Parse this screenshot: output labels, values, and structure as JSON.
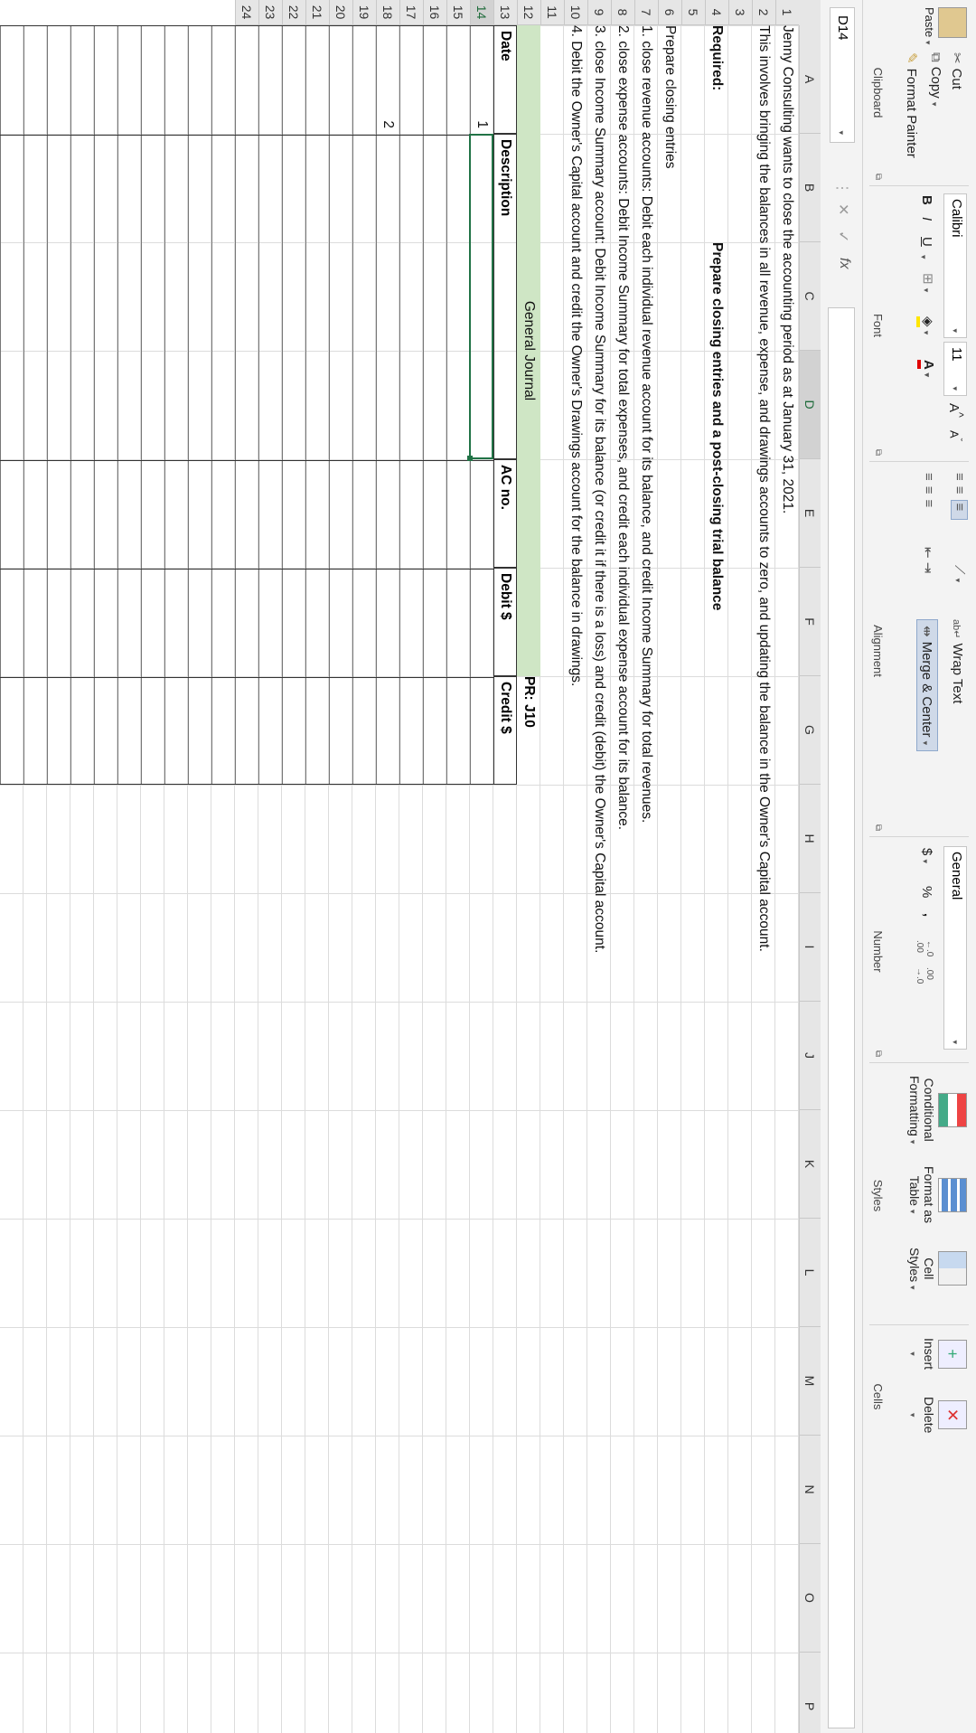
{
  "ribbon": {
    "clipboard": {
      "cut": "Cut",
      "copy": "Copy",
      "paste": "Paste",
      "format_painter": "Format Painter",
      "label": "Clipboard"
    },
    "font": {
      "name": "Calibri",
      "size": "11",
      "grow": "A",
      "shrink": "A",
      "bold": "B",
      "italic": "I",
      "underline": "U",
      "label": "Font"
    },
    "alignment": {
      "wrap_text": "Wrap Text",
      "merge_center": "Merge & Center",
      "label": "Alignment"
    },
    "number": {
      "format": "General",
      "currency": "$",
      "percent": "%",
      "comma": ",",
      "label": "Number"
    },
    "styles": {
      "conditional_1": "Conditional",
      "conditional_2": "Formatting",
      "format_table_1": "Format as",
      "format_table_2": "Table",
      "cell_styles_1": "Cell",
      "cell_styles_2": "Styles",
      "label": "Styles"
    },
    "cells": {
      "insert": "Insert",
      "delete": "Delete",
      "label": "Cells"
    }
  },
  "formula_bar": {
    "name_box": "D14",
    "fx": "fx",
    "formula": ""
  },
  "columns": [
    "A",
    "B",
    "C",
    "D",
    "E",
    "F",
    "G",
    "H",
    "I",
    "J",
    "K",
    "L",
    "M",
    "N",
    "O",
    "P"
  ],
  "rows": [
    "1",
    "2",
    "3",
    "4",
    "5",
    "6",
    "7",
    "8",
    "9",
    "10",
    "11",
    "12",
    "13",
    "14",
    "15",
    "16",
    "17",
    "18",
    "19",
    "20",
    "21",
    "22",
    "23",
    "24"
  ],
  "sheet": {
    "r1": "Jenny Consulting wants to close the accounting period as at January 31, 2021.",
    "r2": "This involves bringing the balances in all revenue, expense, and drawings accounts to zero, and updating the balance in the Owner's Capital account.",
    "r4a": "Required:",
    "r4d": "Prepare closing entries and a post-closing trial balance",
    "r6": "Prepare closing entries",
    "r7": "1. close revenue accounts: Debit each individual revenue account for its balance, and credit Income Summary for total revenues.",
    "r8": "2. close expense accounts: Debit Income Summary for total expenses, and credit each individual expense account for its balance.",
    "r9": "3. close Income Summary account: Debit Income Summary for its balance (or credit it if there is a loss) and credit (debit) the Owner's Capital account.",
    "r10": "4. Debit the Owner's Capital account and credit the Owner's Drawings account for the balance in drawings."
  },
  "journal": {
    "title": "General Journal",
    "pr": "PR: J10",
    "headers": {
      "date": "Date",
      "description": "Description",
      "ac_no": "AC no.",
      "debit": "Debit $",
      "credit": "Credit $"
    },
    "row14_num": "1",
    "row18_num": "2"
  }
}
